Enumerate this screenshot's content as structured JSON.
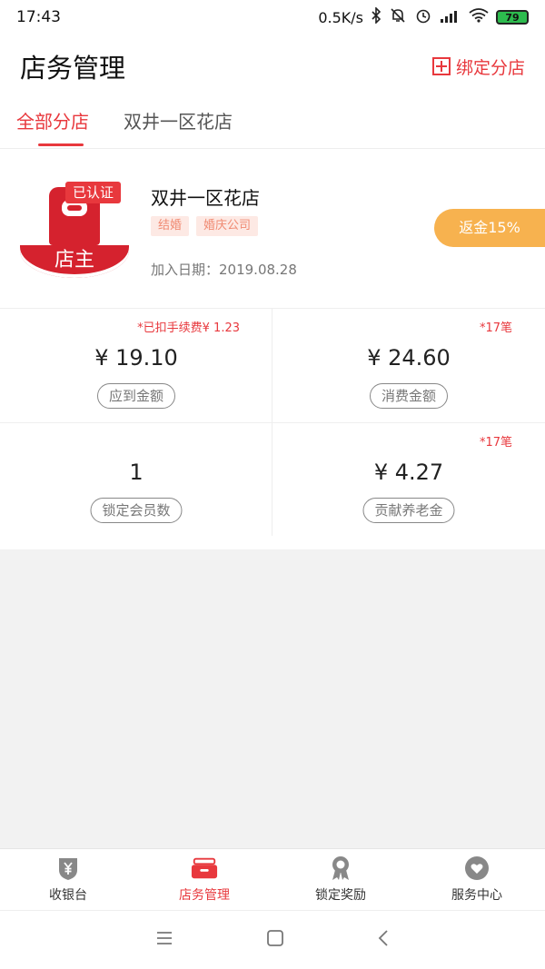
{
  "status_bar": {
    "time": "17:43",
    "network_speed": "0.5K/s",
    "battery": "79"
  },
  "header": {
    "title": "店务管理",
    "bind_branch_label": "绑定分店"
  },
  "tabs": [
    {
      "label": "全部分店",
      "active": true
    },
    {
      "label": "双井一区花店",
      "active": false
    }
  ],
  "shop": {
    "logo_text": "店主",
    "verified_label": "已认证",
    "name": "双井一区花店",
    "tags": [
      "结婚",
      "婚庆公司"
    ],
    "join_date": "加入日期：2019.08.28",
    "rebate": "返金15%"
  },
  "stats": [
    {
      "note": "*已扣手续费¥ 1.23",
      "value": "¥ 19.10",
      "label": "应到金额"
    },
    {
      "note": "*17笔",
      "value": "¥ 24.60",
      "label": "消费金额"
    },
    {
      "note": "",
      "value": "1",
      "label": "锁定会员数"
    },
    {
      "note": "*17笔",
      "value": "¥ 4.27",
      "label": "贡献养老金"
    }
  ],
  "bottom_nav": [
    {
      "label": "收银台",
      "icon": "cashier-shield-icon",
      "active": false
    },
    {
      "label": "店务管理",
      "icon": "store-box-icon",
      "active": true
    },
    {
      "label": "锁定奖励",
      "icon": "award-ribbon-icon",
      "active": false
    },
    {
      "label": "服务中心",
      "icon": "heart-circle-icon",
      "active": false
    }
  ],
  "colors": {
    "accent": "#e8383d",
    "rebate": "#f7b24f",
    "tag_bg": "#fde9e4"
  }
}
